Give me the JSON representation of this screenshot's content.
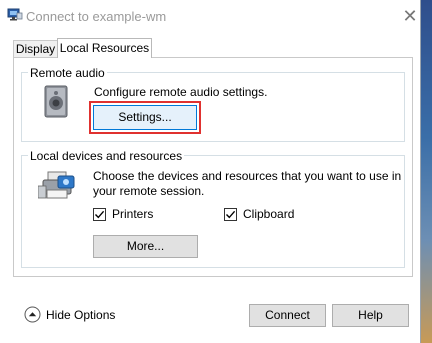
{
  "window": {
    "title": "Connect to example-wm",
    "close_glyph": "✕"
  },
  "tabs": [
    {
      "label": "Display",
      "selected": false
    },
    {
      "label": "Local Resources",
      "selected": true
    }
  ],
  "remote_audio": {
    "group_label": "Remote audio",
    "description": "Configure remote audio settings.",
    "settings_button": "Settings...",
    "icon": "speaker-icon"
  },
  "local_devices": {
    "group_label": "Local devices and resources",
    "description_line1": "Choose the devices and resources that you want to use in",
    "description_line2": "your remote session.",
    "icon": "devices-icon",
    "printers": {
      "label": "Printers",
      "checked": true
    },
    "clipboard": {
      "label": "Clipboard",
      "checked": true
    },
    "more_button": "More..."
  },
  "footer": {
    "hide_options": "Hide Options",
    "connect": "Connect",
    "help": "Help"
  },
  "colors": {
    "accent": "#0078d7",
    "highlight": "#e0312f"
  }
}
